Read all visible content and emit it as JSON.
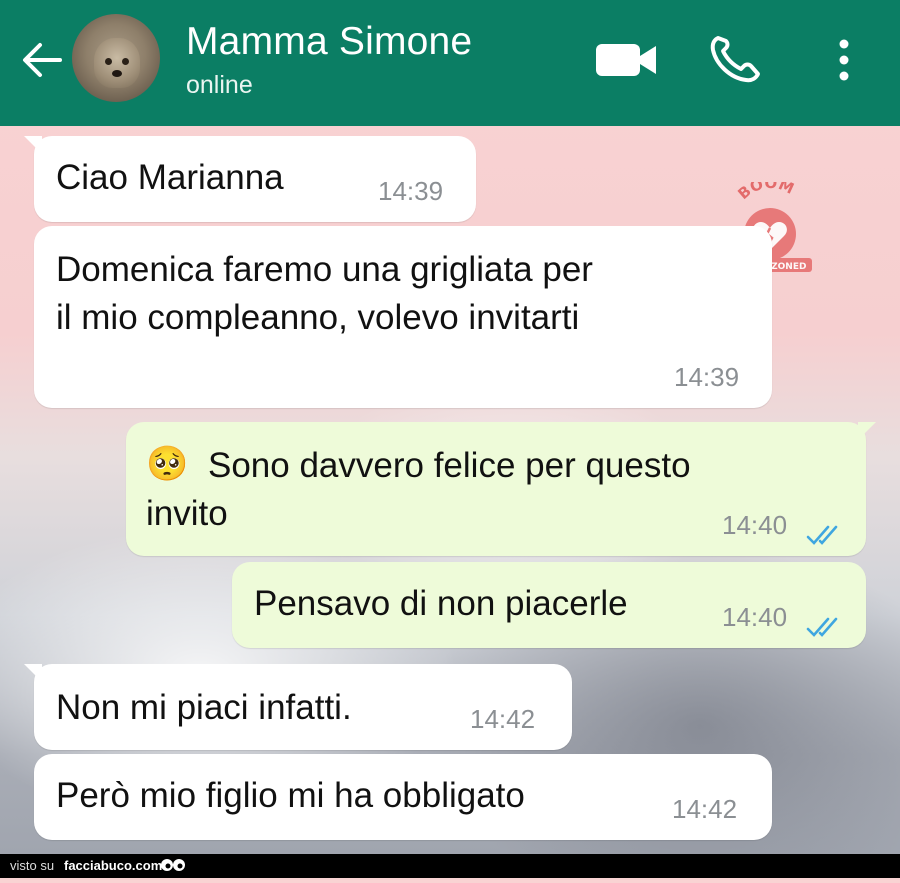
{
  "header": {
    "contact_name": "Mamma Simone",
    "status": "online",
    "icons": [
      "back-arrow-icon",
      "avatar",
      "video-call-icon",
      "phone-icon",
      "more-menu-icon"
    ],
    "bar_color": "#0b7e64"
  },
  "messages": [
    {
      "direction": "in",
      "text": "Ciao Marianna",
      "time": "14:39"
    },
    {
      "direction": "in",
      "lines": [
        "Domenica faremo una grigliata per",
        "il mio compleanno, volevo invitarti"
      ],
      "time": "14:39"
    },
    {
      "direction": "out",
      "emoji": "🥺",
      "lines": [
        "Sono davvero felice per questo",
        "invito"
      ],
      "time": "14:40",
      "status": "read"
    },
    {
      "direction": "out",
      "text": "Pensavo di non piacerle",
      "time": "14:40",
      "status": "read"
    },
    {
      "direction": "in",
      "text": "Non mi piaci infatti.",
      "time": "14:42"
    },
    {
      "direction": "in",
      "text": "Però mio figlio mi ha obbligato",
      "time": "14:42"
    }
  ],
  "watermark": {
    "top_text": "BOOM",
    "bottom_text": "FRIENDZONED"
  },
  "footer": {
    "prefix": "visto su",
    "site": "facciabuco.com"
  },
  "colors": {
    "incoming_bubble": "#ffffff",
    "outgoing_bubble": "#eefbd9",
    "read_ticks": "#3fa6e0"
  }
}
